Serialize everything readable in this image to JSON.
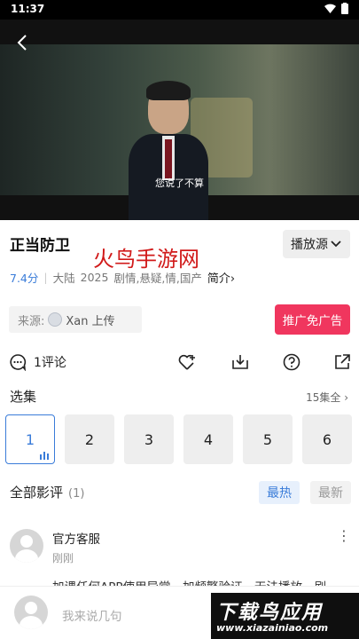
{
  "status_bar": {
    "time": "11:37"
  },
  "video": {
    "subtitle": "您说了不算"
  },
  "show": {
    "title": "正当防卫",
    "score": "7.4分",
    "region": "大陆",
    "year": "2025",
    "genres": "剧情,悬疑,情,国产",
    "intro_label": "简介",
    "intro_chevron": "›"
  },
  "watermark_text": "火鸟手游网",
  "source_button": {
    "label": "播放源",
    "chevron": "⌄"
  },
  "source": {
    "label": "来源:",
    "uploader": "Xan 上传"
  },
  "ad_button": {
    "label": "推广免广告"
  },
  "actions": {
    "comment_label": "1评论"
  },
  "episodes": {
    "title": "选集",
    "count_label": "15集全 ›",
    "items": [
      "1",
      "2",
      "3",
      "4",
      "5",
      "6"
    ],
    "active": "1"
  },
  "reviews": {
    "title": "全部影评",
    "count": "(1)",
    "sort_hot": "最热",
    "sort_new": "最新",
    "items": [
      {
        "name": "官方客服",
        "time": "刚刚",
        "text": "加课任何APP使用异常，加频繁验证，无法播放，刷"
      }
    ]
  },
  "comment_input": {
    "placeholder": "我来说几句"
  },
  "brand": {
    "name": "下载鸟应用",
    "url": "www.xiazainiao.com"
  },
  "colors": {
    "accent": "#3a7cd9",
    "ad": "#f0365e",
    "watermark": "#d11a1a"
  }
}
